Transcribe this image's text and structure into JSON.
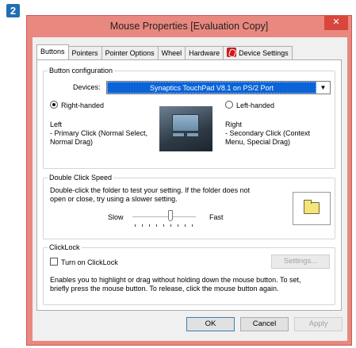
{
  "step_badge": "2",
  "window": {
    "title": "Mouse Properties [Evaluation Copy]",
    "close_glyph": "✕"
  },
  "tabs": [
    {
      "label": "Buttons",
      "active": true
    },
    {
      "label": "Pointers",
      "active": false
    },
    {
      "label": "Pointer Options",
      "active": false
    },
    {
      "label": "Wheel",
      "active": false
    },
    {
      "label": "Hardware",
      "active": false
    },
    {
      "label": "Device Settings",
      "active": false,
      "icon": "synaptics-device-icon"
    }
  ],
  "button_config": {
    "group_title": "Button configuration",
    "devices_label": "Devices:",
    "devices_value": "Synaptics TouchPad V8.1 on PS/2 Port",
    "right_handed_label": "Right-handed",
    "left_handed_label": "Left-handed",
    "selected": "right-handed",
    "left_desc_line1": "Left",
    "left_desc_line2": " - Primary Click (Normal Select,",
    "left_desc_line3": "Normal Drag)",
    "right_desc_line1": "Right",
    "right_desc_line2": " - Secondary Click (Context",
    "right_desc_line3": "Menu, Special Drag)"
  },
  "double_click": {
    "group_title": "Double Click Speed",
    "desc_line1": "Double-click the folder to test your setting.  If the folder does not",
    "desc_line2": "open or close, try using a slower setting.",
    "slow_label": "Slow",
    "fast_label": "Fast",
    "slider_level": 0.6
  },
  "clicklock": {
    "group_title": "ClickLock",
    "checkbox_label": "Turn on ClickLock",
    "checked": false,
    "settings_button": "Settings...",
    "desc_line1": "Enables you to highlight or drag without holding down the mouse button.  To set,",
    "desc_line2": "briefly press the mouse button.  To release, click the mouse button again."
  },
  "footer": {
    "ok": "OK",
    "cancel": "Cancel",
    "apply": "Apply"
  },
  "colors": {
    "title_bar": "#e9887f",
    "close_button": "#d9463c",
    "selection": "#0a64d8",
    "badge": "#1f6fb4"
  }
}
